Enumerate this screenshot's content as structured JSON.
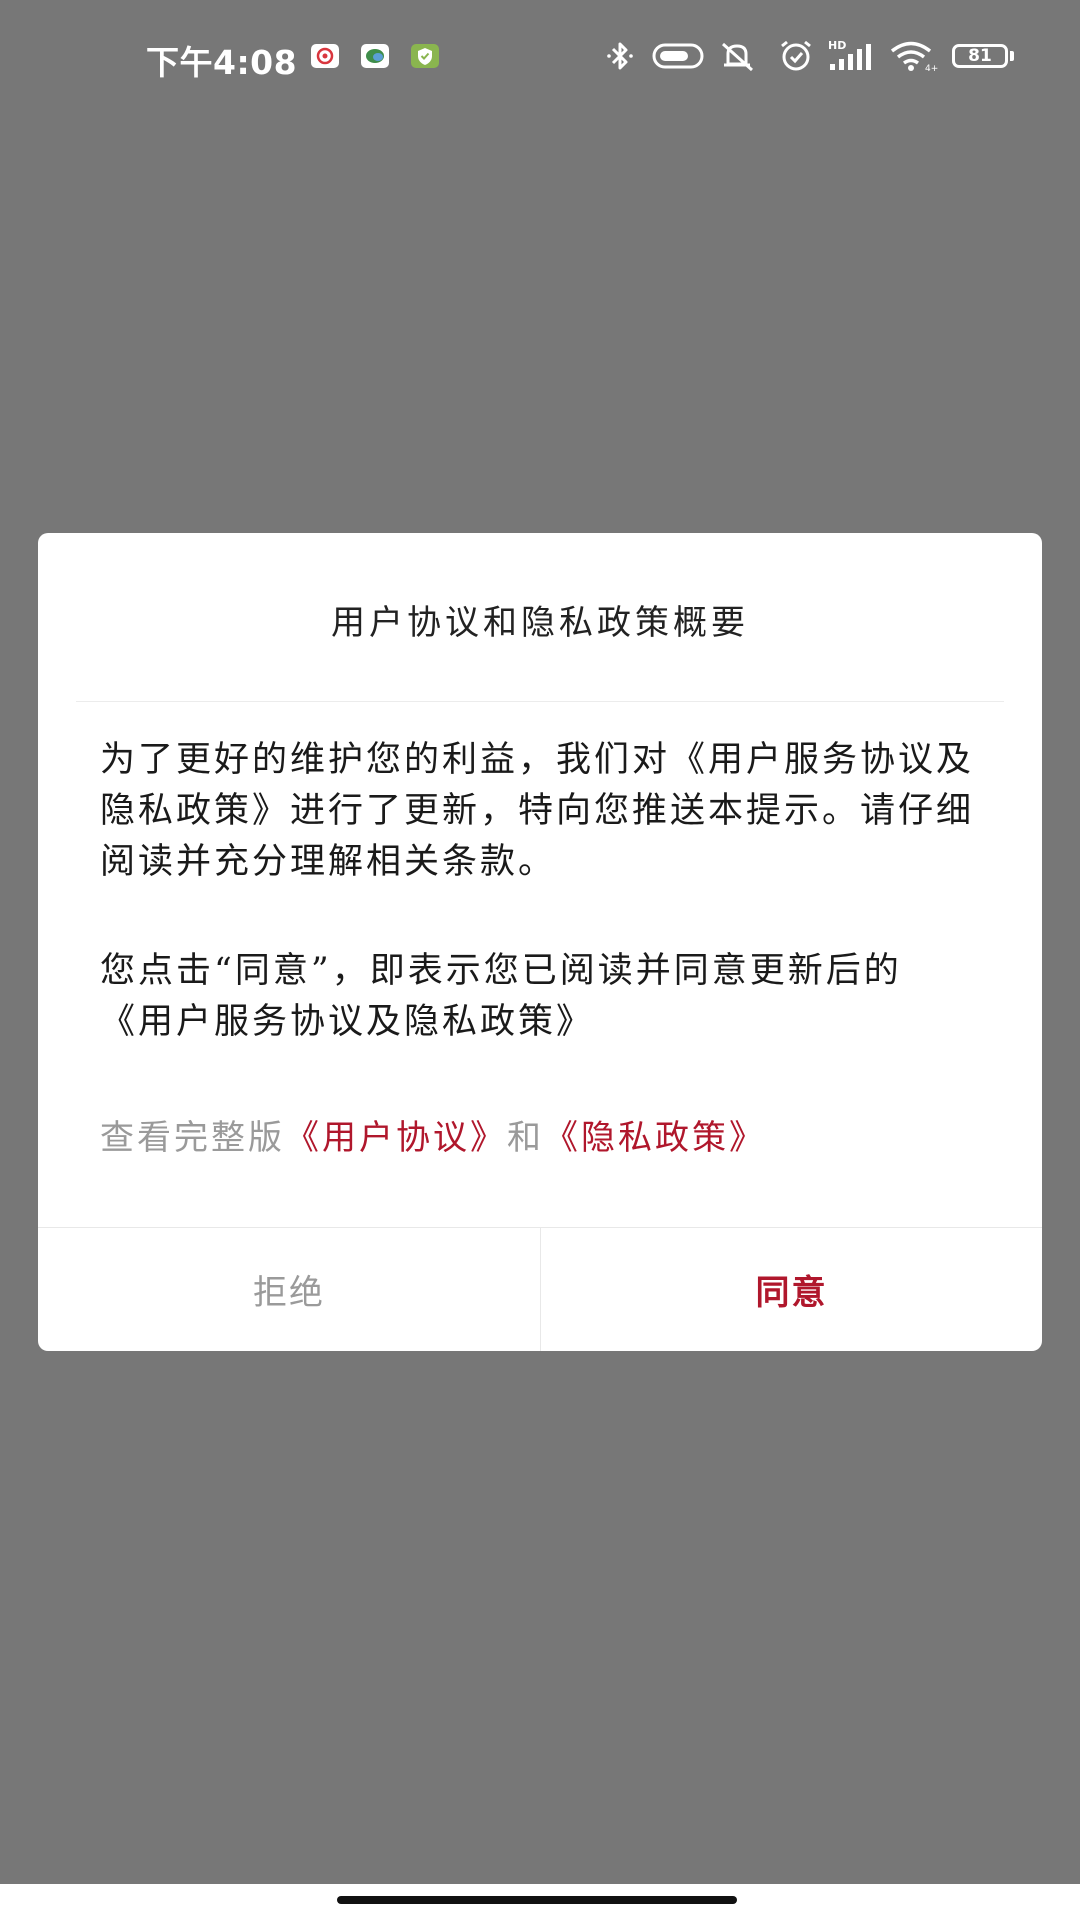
{
  "status_bar": {
    "time": "下午4:08",
    "battery_level": "81",
    "icons": [
      "netease-music-icon",
      "chat-app-icon",
      "shield-app-icon",
      "bluetooth-icon",
      "vpn-icon",
      "mute-icon",
      "alarm-icon",
      "hd-signal-icon",
      "wifi-icon",
      "battery-icon"
    ]
  },
  "dialog": {
    "title": "用户协议和隐私政策概要",
    "paragraph1": "为了更好的维护您的利益，我们对《用户服务协议及隐私政策》进行了更新，特向您推送本提示。请仔细阅读并充分理解相关条款。",
    "paragraph2": "您点击“同意”，即表示您已阅读并同意更新后的 《用户服务协议及隐私政策》",
    "view_full_prefix": "查看完整版",
    "user_agreement_link": "《用户协议》",
    "and_text": "和",
    "privacy_policy_link": "《隐私政策》",
    "reject_label": "拒绝",
    "agree_label": "同意"
  },
  "colors": {
    "overlay": "#777777",
    "accent": "#b0172c",
    "muted_text": "#9a9a9a"
  }
}
